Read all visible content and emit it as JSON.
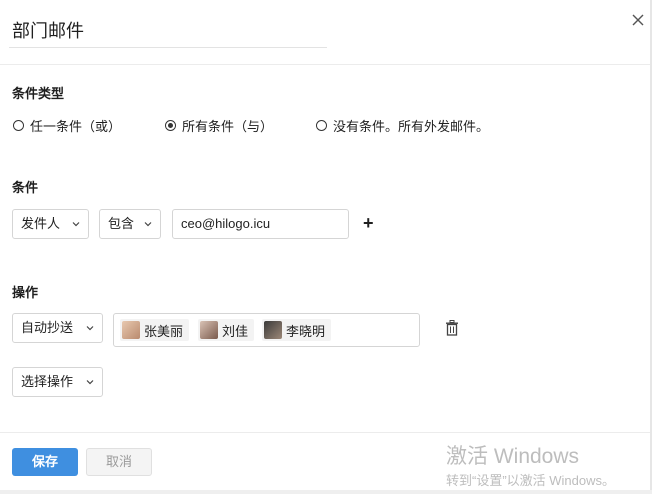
{
  "title_value": "部门邮件",
  "close_icon": "close-icon",
  "condition_type": {
    "label": "条件类型",
    "options": [
      {
        "label": "任一条件（或）",
        "selected": false
      },
      {
        "label": "所有条件（与）",
        "selected": true
      },
      {
        "label": "没有条件。所有外发邮件。",
        "selected": false
      }
    ]
  },
  "conditions": {
    "label": "条件",
    "field": "发件人",
    "operator": "包含",
    "value": "ceo@hilogo.icu",
    "add_symbol": "+"
  },
  "actions": {
    "label": "操作",
    "action": "自动抄送",
    "recipients": [
      "张美丽",
      "刘佳",
      "李晓明"
    ],
    "choose_action": "选择操作"
  },
  "footer": {
    "save": "保存",
    "cancel": "取消"
  },
  "watermark": {
    "line1": "激活 Windows",
    "line2": "转到“设置”以激活 Windows。"
  },
  "colors": {
    "primary": "#3f8fe0"
  }
}
